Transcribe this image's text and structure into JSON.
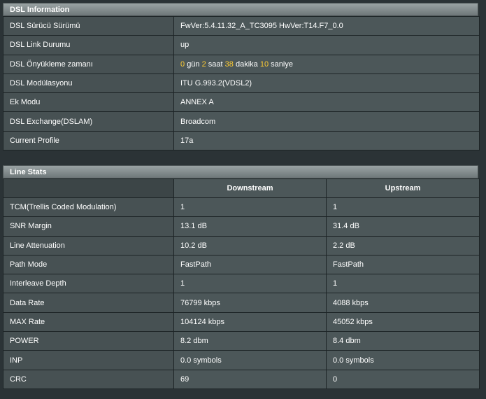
{
  "dsl_info": {
    "title": "DSL Information",
    "rows": [
      {
        "label": "DSL Sürücü Sürümü",
        "value": "FwVer:5.4.11.32_A_TC3095 HwVer:T14.F7_0.0"
      },
      {
        "label": "DSL Link Durumu",
        "value": "up"
      },
      {
        "label": "DSL Önyükleme zamanı"
      },
      {
        "label": "DSL Modülasyonu",
        "value": "ITU G.993.2(VDSL2)"
      },
      {
        "label": "Ek Modu",
        "value": "ANNEX A"
      },
      {
        "label": "DSL Exchange(DSLAM)",
        "value": "Broadcom"
      },
      {
        "label": "Current Profile",
        "value": "17a"
      }
    ],
    "uptime": {
      "days": "0",
      "days_unit": "gün",
      "hours": "2",
      "hours_unit": "saat",
      "minutes": "38",
      "minutes_unit": "dakika",
      "seconds": "10",
      "seconds_unit": "saniye"
    },
    "highlight_color": "#ffcc33"
  },
  "line_stats": {
    "title": "Line Stats",
    "columns": {
      "downstream": "Downstream",
      "upstream": "Upstream"
    },
    "rows": [
      {
        "label": "TCM(Trellis Coded Modulation)",
        "down": "1",
        "up": "1"
      },
      {
        "label": "SNR Margin",
        "down": "13.1 dB",
        "up": "31.4 dB"
      },
      {
        "label": "Line Attenuation",
        "down": "10.2 dB",
        "up": "2.2 dB"
      },
      {
        "label": "Path Mode",
        "down": "FastPath",
        "up": "FastPath"
      },
      {
        "label": "Interleave Depth",
        "down": "1",
        "up": "1"
      },
      {
        "label": "Data Rate",
        "down": "76799 kbps",
        "up": "4088 kbps"
      },
      {
        "label": "MAX Rate",
        "down": "104124 kbps",
        "up": "45052 kbps"
      },
      {
        "label": "POWER",
        "down": "8.2 dbm",
        "up": "8.4 dbm"
      },
      {
        "label": "INP",
        "down": "0.0 symbols",
        "up": "0.0 symbols"
      },
      {
        "label": "CRC",
        "down": "69",
        "up": "0"
      }
    ]
  }
}
